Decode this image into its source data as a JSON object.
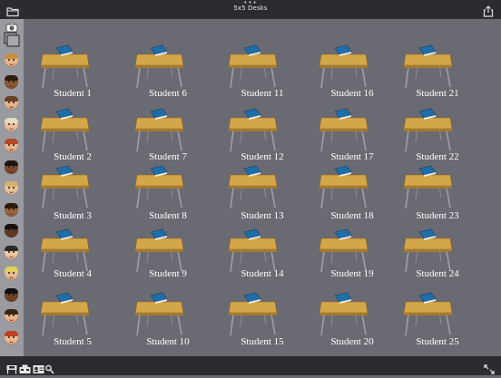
{
  "window": {
    "title": "5x5 Desks",
    "handle": "•••"
  },
  "toolbar": {
    "folder_icon": "folder-icon",
    "share_icon": "share-icon"
  },
  "sidebar": {
    "tools": [
      "camera-icon",
      "layers-icon"
    ],
    "faces": [
      {
        "skin": "#e8b88a",
        "hair": "#c69040"
      },
      {
        "skin": "#8a5a36",
        "hair": "#2c1c10"
      },
      {
        "skin": "#e6b48c",
        "hair": "#6a4020"
      },
      {
        "skin": "#f0c29a",
        "hair": "#e8dcc0"
      },
      {
        "skin": "#e9b38e",
        "hair": "#b84828"
      },
      {
        "skin": "#7a4a2e",
        "hair": "#1e140c"
      },
      {
        "skin": "#edc29a",
        "hair": "#d8b070"
      },
      {
        "skin": "#9a643c",
        "hair": "#2a1a10"
      },
      {
        "skin": "#5e3a22",
        "hair": "#1a100a"
      },
      {
        "skin": "#f0c8a0",
        "hair": "#2a2a2a"
      },
      {
        "skin": "#e8bc92",
        "hair": "#e0d060"
      },
      {
        "skin": "#6e4428",
        "hair": "#141010"
      },
      {
        "skin": "#eab48a",
        "hair": "#3a2414"
      },
      {
        "skin": "#f0b890",
        "hair": "#c04020"
      }
    ]
  },
  "desks": {
    "labels": [
      "Student 1",
      "Student 2",
      "Student 3",
      "Student 4",
      "Student 5",
      "Student 6",
      "Student 7",
      "Student 8",
      "Student 9",
      "Student 10",
      "Student 11",
      "Student 12",
      "Student 13",
      "Student 14",
      "Student 15",
      "Student 16",
      "Student 17",
      "Student 18",
      "Student 19",
      "Student 20",
      "Student 21",
      "Student 22",
      "Student 23",
      "Student 24",
      "Student 25"
    ]
  },
  "bottom_toolbar": {
    "icons": [
      "desk-icon",
      "teacher-desk-icon",
      "id-card-icon",
      "settings-icon",
      "fullscreen-icon"
    ]
  },
  "colors": {
    "background": "#6a6a72",
    "desk_top": "#d4a64a",
    "book": "#1e6ea8"
  }
}
